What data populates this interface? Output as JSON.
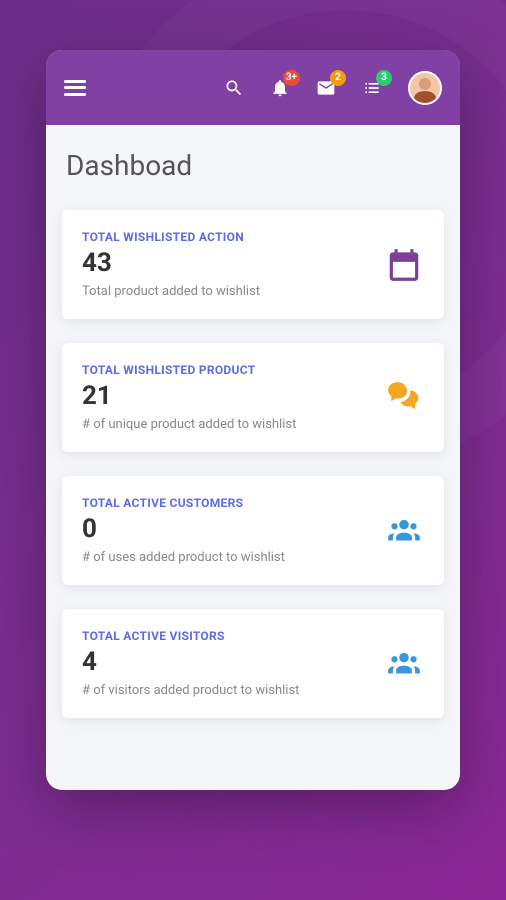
{
  "header": {
    "badges": {
      "notifications": "3+",
      "messages": "2",
      "tasks": "3"
    }
  },
  "page": {
    "title": "Dashboad"
  },
  "cards": [
    {
      "label": "TOTAL WISHLISTED ACTION",
      "value": "43",
      "description": "Total product added to wishlist",
      "icon": "calendar",
      "color": "purple"
    },
    {
      "label": "TOTAL WISHLISTED PRODUCT",
      "value": "21",
      "description": "# of unique product added to wishlist",
      "icon": "comments",
      "color": "orange"
    },
    {
      "label": "TOTAL ACTIVE CUSTOMERS",
      "value": "0",
      "description": "# of uses added product to wishlist",
      "icon": "users",
      "color": "blue"
    },
    {
      "label": "TOTAL ACTIVE VISITORS",
      "value": "4",
      "description": "# of visitors added product to wishlist",
      "icon": "users",
      "color": "blue"
    }
  ]
}
